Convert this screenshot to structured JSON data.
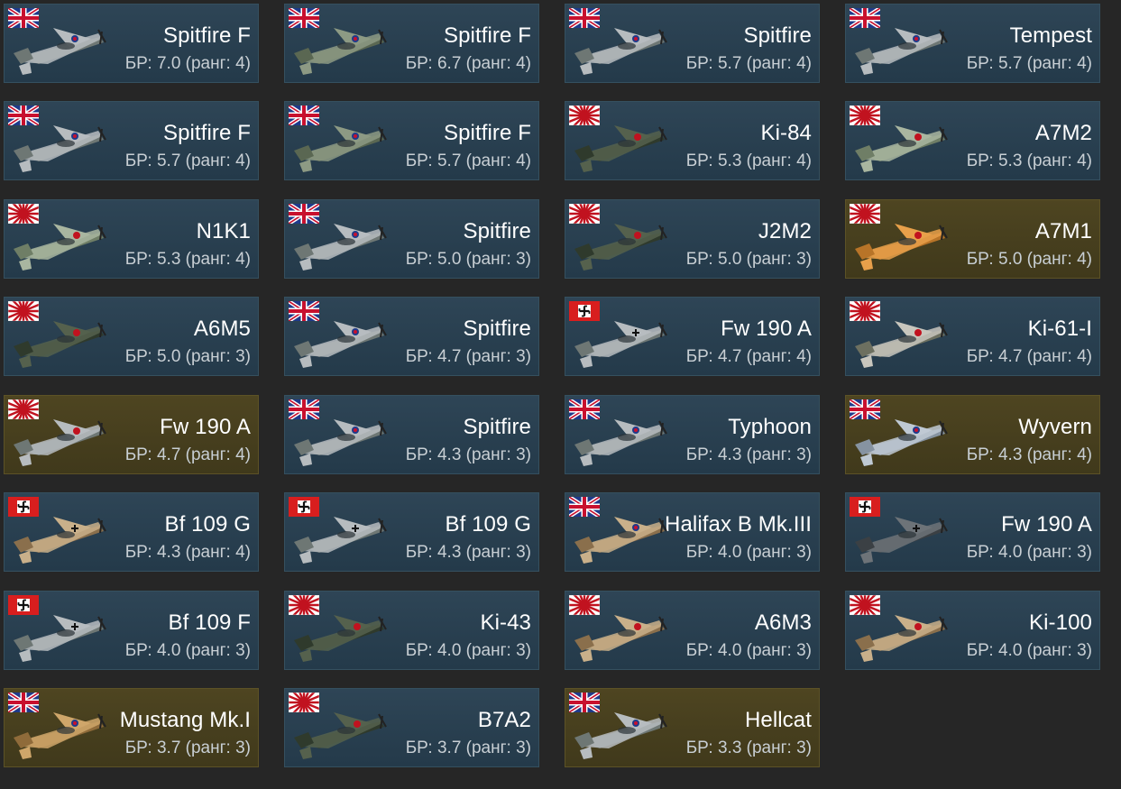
{
  "colors": {
    "background": "#262626",
    "card_normal": "#2a4050",
    "card_premium": "#4a421f"
  },
  "vehicles": [
    {
      "name": "Spitfire F",
      "br": "БР: 7.0 (ранг: 4)",
      "nation": "uk",
      "premium": false,
      "camo": "grey"
    },
    {
      "name": "Spitfire F",
      "br": "БР: 6.7 (ранг: 4)",
      "nation": "uk",
      "premium": false,
      "camo": "green"
    },
    {
      "name": "Spitfire",
      "br": "БР: 5.7 (ранг: 4)",
      "nation": "uk",
      "premium": false,
      "camo": "grey"
    },
    {
      "name": "Tempest",
      "br": "БР: 5.7 (ранг: 4)",
      "nation": "uk",
      "premium": false,
      "camo": "grey"
    },
    {
      "name": "Spitfire F",
      "br": "БР: 5.7 (ранг: 4)",
      "nation": "uk",
      "premium": false,
      "camo": "grey"
    },
    {
      "name": "Spitfire F",
      "br": "БР: 5.7 (ранг: 4)",
      "nation": "uk",
      "premium": false,
      "camo": "green"
    },
    {
      "name": "Ki-84",
      "br": "БР: 5.3 (ранг: 4)",
      "nation": "japan",
      "premium": false,
      "camo": "darkgreen"
    },
    {
      "name": "A7M2",
      "br": "БР: 5.3 (ранг: 4)",
      "nation": "japan",
      "premium": false,
      "camo": "lightgreen"
    },
    {
      "name": "N1K1",
      "br": "БР: 5.3 (ранг: 4)",
      "nation": "japan",
      "premium": false,
      "camo": "lightgreen"
    },
    {
      "name": "Spitfire",
      "br": "БР: 5.0 (ранг: 3)",
      "nation": "uk",
      "premium": false,
      "camo": "grey"
    },
    {
      "name": "J2M2",
      "br": "БР: 5.0 (ранг: 3)",
      "nation": "japan",
      "premium": false,
      "camo": "darkgreen"
    },
    {
      "name": "A7M1",
      "br": "БР: 5.0 (ранг: 4)",
      "nation": "japan",
      "premium": true,
      "camo": "orange"
    },
    {
      "name": "A6M5",
      "br": "БР: 5.0 (ранг: 3)",
      "nation": "japan",
      "premium": false,
      "camo": "darkgreen"
    },
    {
      "name": "Spitfire",
      "br": "БР: 4.7 (ранг: 3)",
      "nation": "uk",
      "premium": false,
      "camo": "grey"
    },
    {
      "name": "Fw 190 A",
      "br": "БР: 4.7 (ранг: 4)",
      "nation": "germany",
      "premium": false,
      "camo": "grey"
    },
    {
      "name": "Ki-61-I",
      "br": "БР: 4.7 (ранг: 4)",
      "nation": "japan",
      "premium": false,
      "camo": "mottled"
    },
    {
      "name": "Fw 190 A",
      "br": "БР: 4.7 (ранг: 4)",
      "nation": "japan",
      "premium": true,
      "camo": "grey"
    },
    {
      "name": "Spitfire",
      "br": "БР: 4.3 (ранг: 3)",
      "nation": "uk",
      "premium": false,
      "camo": "grey"
    },
    {
      "name": "Typhoon",
      "br": "БР: 4.3 (ранг: 3)",
      "nation": "uk",
      "premium": false,
      "camo": "grey"
    },
    {
      "name": "Wyvern",
      "br": "БР: 4.3 (ранг: 4)",
      "nation": "uk",
      "premium": true,
      "camo": "lightblue"
    },
    {
      "name": "Bf 109 G",
      "br": "БР: 4.3 (ранг: 4)",
      "nation": "germany",
      "premium": false,
      "camo": "tan"
    },
    {
      "name": "Bf 109 G",
      "br": "БР: 4.3 (ранг: 3)",
      "nation": "germany",
      "premium": false,
      "camo": "grey"
    },
    {
      "name": "Halifax B Mk.III",
      "br": "БР: 4.0 (ранг: 3)",
      "nation": "uk",
      "premium": false,
      "camo": "tan"
    },
    {
      "name": "Fw 190 A",
      "br": "БР: 4.0 (ранг: 3)",
      "nation": "germany",
      "premium": false,
      "camo": "darkgrey"
    },
    {
      "name": "Bf 109 F",
      "br": "БР: 4.0 (ранг: 3)",
      "nation": "germany",
      "premium": false,
      "camo": "grey"
    },
    {
      "name": "Ki-43",
      "br": "БР: 4.0 (ранг: 3)",
      "nation": "japan",
      "premium": false,
      "camo": "darkgreen"
    },
    {
      "name": "A6M3",
      "br": "БР: 4.0 (ранг: 3)",
      "nation": "japan",
      "premium": false,
      "camo": "tan"
    },
    {
      "name": "Ki-100",
      "br": "БР: 4.0 (ранг: 3)",
      "nation": "japan",
      "premium": false,
      "camo": "tan"
    },
    {
      "name": "Mustang Mk.I",
      "br": "БР: 3.7 (ранг: 3)",
      "nation": "uk",
      "premium": true,
      "camo": "desert"
    },
    {
      "name": "B7A2",
      "br": "БР: 3.7 (ранг: 3)",
      "nation": "japan",
      "premium": false,
      "camo": "darkgreen"
    },
    {
      "name": "Hellcat",
      "br": "БР: 3.3 (ранг: 3)",
      "nation": "uk",
      "premium": true,
      "camo": "grey"
    }
  ]
}
